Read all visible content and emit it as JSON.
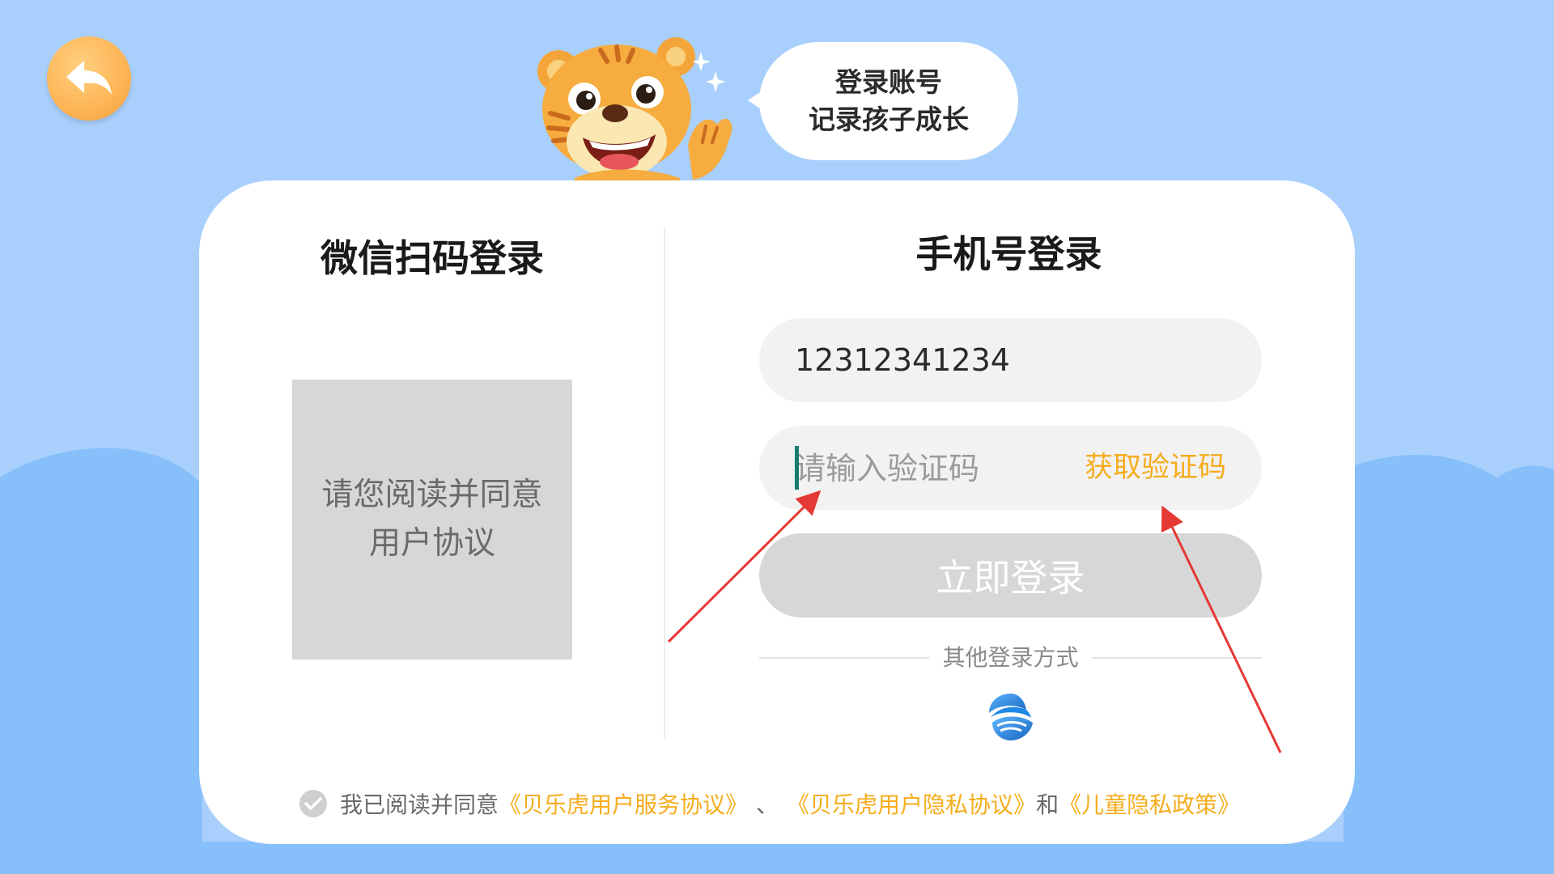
{
  "bubble": {
    "line1": "登录账号",
    "line2": "记录孩子成长"
  },
  "wechat": {
    "title": "微信扫码登录",
    "qr_notice_line1": "请您阅读并同意",
    "qr_notice_line2": "用户协议"
  },
  "phone_login": {
    "title": "手机号登录",
    "phone_value": "12312341234",
    "code_placeholder": "请输入验证码",
    "get_code_label": "获取验证码",
    "login_button_label": "立即登录",
    "other_methods_label": "其他登录方式"
  },
  "agreement": {
    "prefix": "我已阅读并同意",
    "link1": "《贝乐虎用户服务协议》",
    "sep1": "、",
    "link2": "《贝乐虎用户隐私协议》",
    "sep2": "和",
    "link3": "《儿童隐私政策》"
  },
  "icons": {
    "back": "back-arrow-icon",
    "mascot": "tiger-mascot",
    "sparkle": "sparkle-icon",
    "china_mobile": "china-mobile-logo-icon",
    "check": "check-circle-icon"
  },
  "colors": {
    "background": "#a9d0fc",
    "accent_orange": "#f5ad1e",
    "button_disabled": "#d7d7d7",
    "input_bg": "#f2f2f2"
  }
}
